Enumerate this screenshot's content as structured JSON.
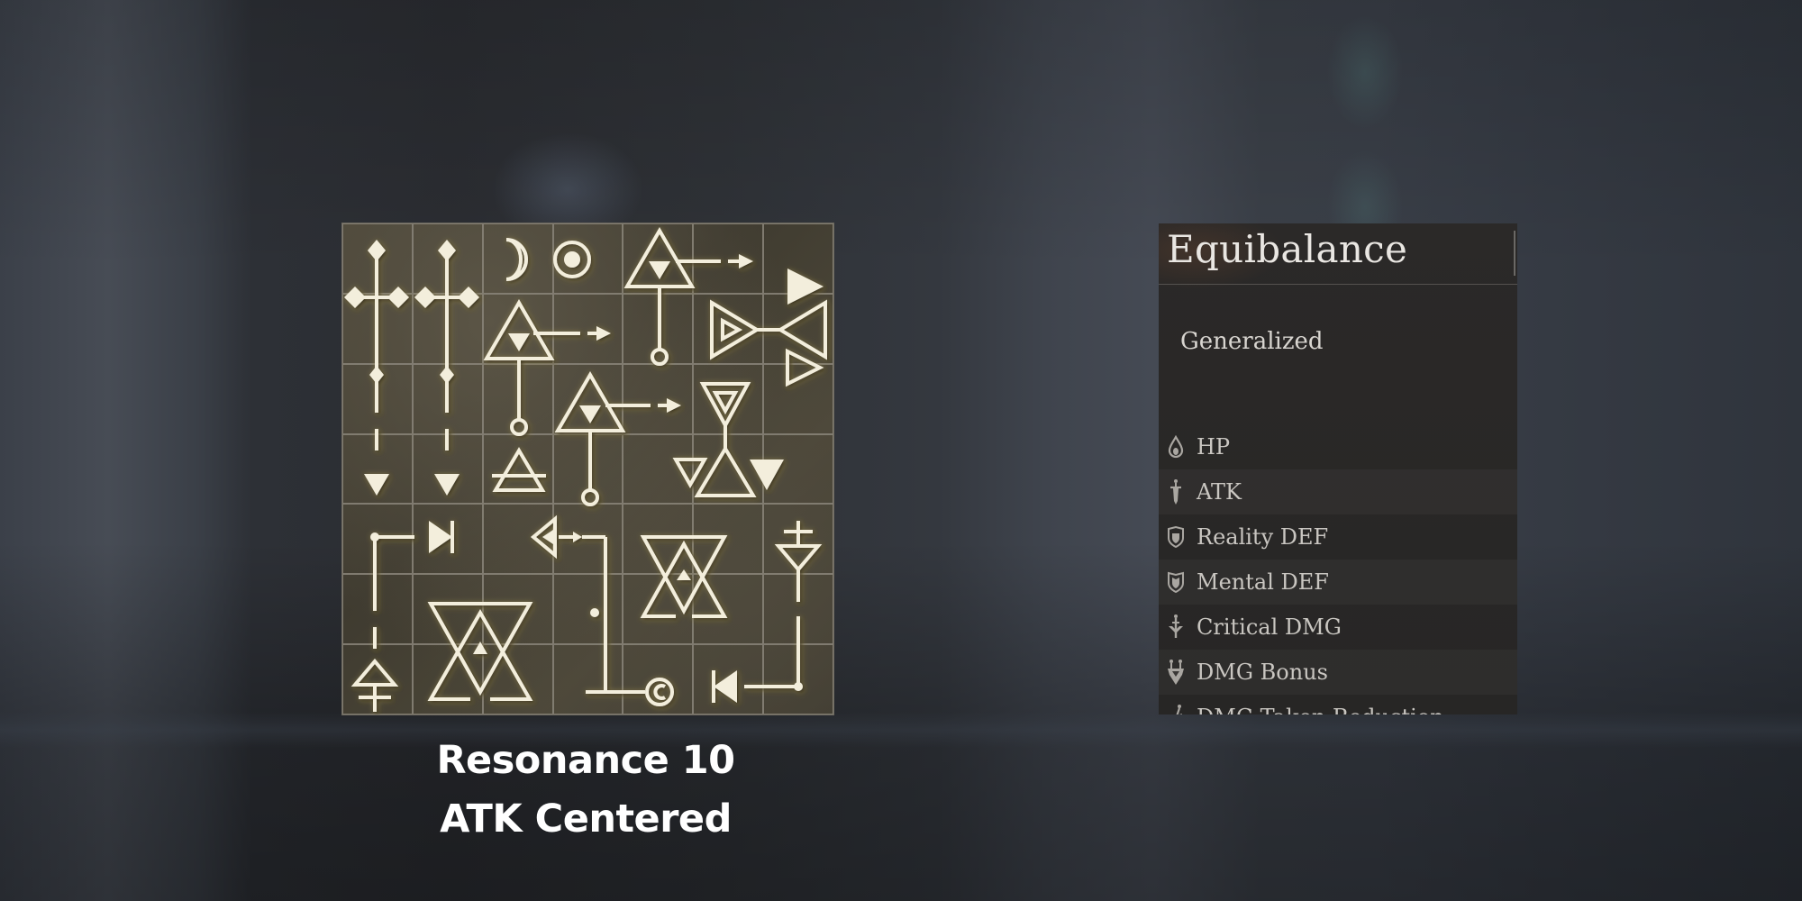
{
  "caption": {
    "line1": "Resonance 10",
    "line2": "ATK Centered"
  },
  "resonance_grid": {
    "rows": 7,
    "columns": 7,
    "pieces_description": [
      "cross-sword-left",
      "cross-sword-right",
      "crescent-and-circle",
      "triforce-arrow-top",
      "triforce-arrow-mid",
      "triforce-arrow-low",
      "bowtie-triangles",
      "hourglass-triangles",
      "alchemy-triangle-small",
      "circuit-left",
      "hexagram-left",
      "hexagram-right",
      "circuit-right"
    ],
    "colors": {
      "symbol": "#f3eedc",
      "grid_line": "#8a857a"
    }
  },
  "stats_panel": {
    "title": "Equibalance",
    "subtitle": "Generalized",
    "stats": [
      {
        "label": "HP",
        "icon": "drop-icon"
      },
      {
        "label": "ATK",
        "icon": "sword-icon"
      },
      {
        "label": "Reality DEF",
        "icon": "shield-icon"
      },
      {
        "label": "Mental DEF",
        "icon": "mental-shield-icon"
      },
      {
        "label": "Critical DMG",
        "icon": "critical-icon"
      },
      {
        "label": "DMG Bonus",
        "icon": "dmg-bonus-icon"
      },
      {
        "label": "DMG Taken Reduction",
        "icon": "dmg-reduction-icon"
      }
    ]
  }
}
